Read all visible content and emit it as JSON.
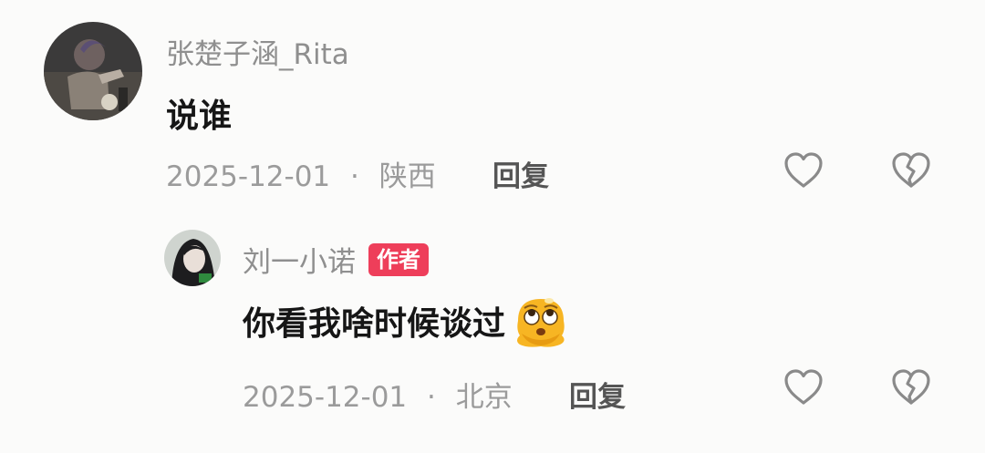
{
  "comments": [
    {
      "username": "张楚子涵_Rita",
      "text": "说谁",
      "date": "2025-12-01",
      "separator": "·",
      "location": "陕西",
      "reply_label": "回复",
      "avatar_icon": "user-avatar-photo"
    }
  ],
  "replies": [
    {
      "username": "刘一小诺",
      "badge": "作者",
      "text": "你看我啥时候谈过",
      "emoji_icon": "rolling-eyes-emoji",
      "date": "2025-12-01",
      "separator": "·",
      "location": "北京",
      "reply_label": "回复",
      "avatar_icon": "user-avatar-photo"
    }
  ],
  "icons": {
    "like": "heart-outline-icon",
    "dislike": "broken-heart-icon"
  },
  "colors": {
    "background": "#fbfbfa",
    "username": "#8f8f8f",
    "content": "#161616",
    "meta": "#9b9b9b",
    "badge": "#ee3e5a",
    "icon_stroke": "#8a8a8a"
  }
}
